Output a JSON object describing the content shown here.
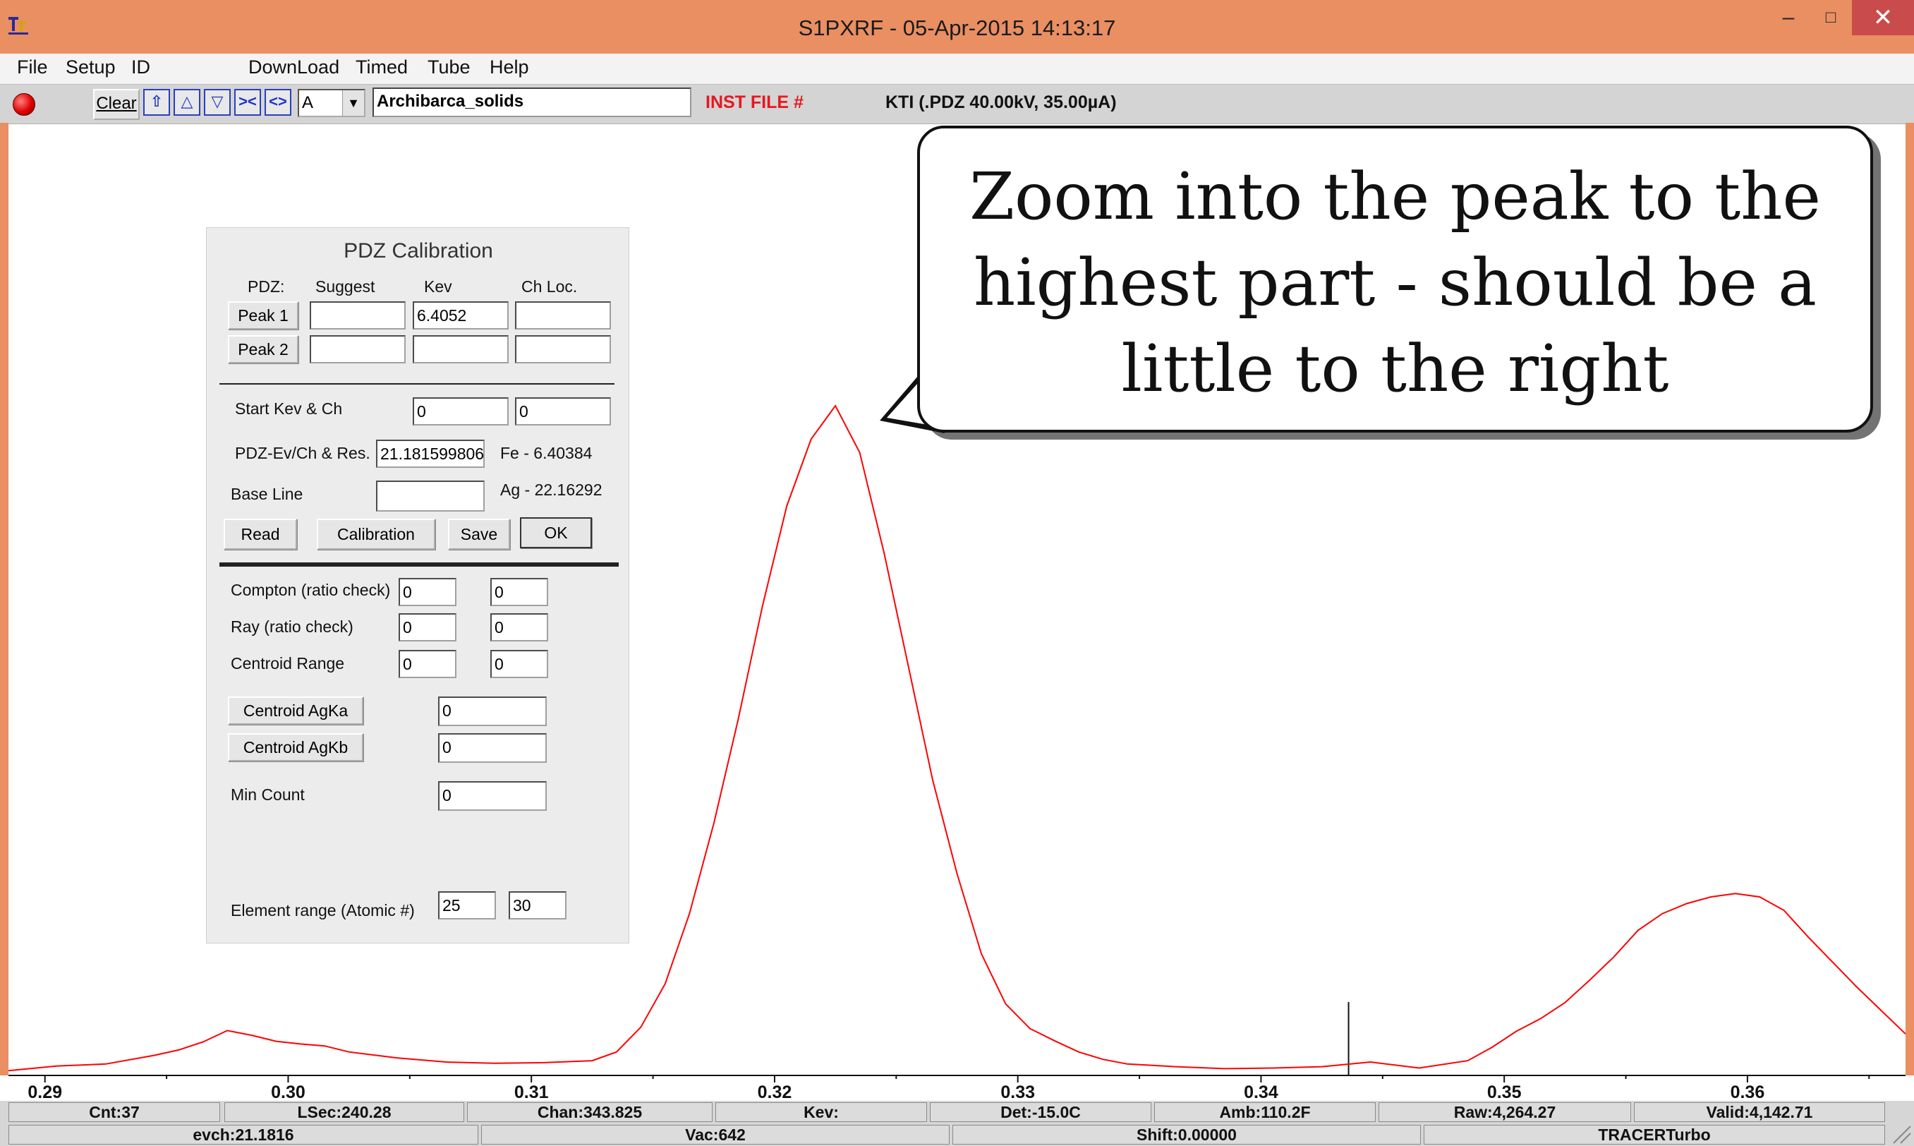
{
  "window": {
    "title": "S1PXRF - 05-Apr-2015 14:13:17",
    "controls": {
      "minimize": "–",
      "maximize": "□",
      "close": "✕"
    }
  },
  "menu": [
    "File",
    "Setup",
    "ID",
    "DownLoad",
    "Timed",
    "Tube",
    "Help"
  ],
  "toolbar": {
    "clear_label": "Clear",
    "nav_buttons": [
      "home-up-icon",
      "arrow-up-icon",
      "arrow-down-icon",
      "collapse-icon",
      "expand-icon"
    ],
    "nav_glyphs": [
      "⇧",
      "△",
      "▽",
      "><",
      "<>"
    ],
    "channel_value": "A",
    "file_name": "Archibarca_solids",
    "inst_file_label": "INST FILE #",
    "kti_label": "KTI  (.PDZ 40.00kV, 35.00µA)",
    "status_led_color": "#e00000"
  },
  "pdz_panel": {
    "title": "PDZ Calibration",
    "col_headers": {
      "pdz": "PDZ:",
      "suggest": "Suggest",
      "kev": "Kev",
      "chloc": "Ch Loc."
    },
    "peak1": {
      "label": "Peak 1",
      "suggest": "",
      "kev": "6.4052",
      "chloc": ""
    },
    "peak2": {
      "label": "Peak 2",
      "suggest": "",
      "kev": "",
      "chloc": ""
    },
    "start_kev_label": "Start Kev & Ch",
    "start_kev": "0",
    "start_ch": "0",
    "ev_ch_label": "PDZ-Ev/Ch & Res.",
    "ev_ch_value": "21.181599806",
    "fe_ref": "Fe - 6.40384",
    "baseline_label": "Base Line",
    "baseline_value": "",
    "ag_ref": "Ag - 22.16292",
    "buttons": {
      "read": "Read",
      "calibration": "Calibration",
      "save": "Save",
      "ok": "OK"
    },
    "compton_label": "Compton (ratio check)",
    "compton": [
      "0",
      "0"
    ],
    "ray_label": "Ray (ratio check)",
    "ray": [
      "0",
      "0"
    ],
    "centroid_range_label": "Centroid Range",
    "centroid_range": [
      "0",
      "0"
    ],
    "centroid_agka_label": "Centroid AgKa",
    "centroid_agka": "0",
    "centroid_agkb_label": "Centroid AgKb",
    "centroid_agkb": "0",
    "min_count_label": "Min Count",
    "min_count": "0",
    "element_range_label": "Element range (Atomic #)",
    "element_range": [
      "25",
      "30"
    ]
  },
  "callout": {
    "line1": "Zoom into the peak to the",
    "line2": "highest part - should be a",
    "line3": "little to the right"
  },
  "chart_data": {
    "type": "line",
    "x_tick_labels": [
      "0.29",
      "0.30",
      "0.31",
      "0.32",
      "0.33",
      "0.34",
      "0.35",
      "0.36"
    ],
    "xlim": [
      0.2885,
      0.3665
    ],
    "ylim": [
      0,
      100
    ],
    "cursor_x": 0.3436,
    "line_color": "#ff0000",
    "series": [
      {
        "x": [
          0.2885,
          0.2905,
          0.2925,
          0.2945,
          0.2955,
          0.2965,
          0.2975,
          0.2985,
          0.2995,
          0.3005,
          0.3015,
          0.3025,
          0.3045,
          0.3065,
          0.3085,
          0.3105,
          0.3125,
          0.3135,
          0.3145,
          0.3155,
          0.3165,
          0.3175,
          0.3185,
          0.3195,
          0.3205,
          0.3215,
          0.3225,
          0.3235,
          0.3245,
          0.3255,
          0.3265,
          0.3275,
          0.3285,
          0.3295,
          0.3305,
          0.3315,
          0.3325,
          0.3335,
          0.3345,
          0.3365,
          0.3385,
          0.3405,
          0.3425,
          0.3445,
          0.3465,
          0.3485,
          0.3495,
          0.3505,
          0.3515,
          0.3525,
          0.3535,
          0.3545,
          0.3555,
          0.3565,
          0.3575,
          0.3585,
          0.3595,
          0.3605,
          0.3615,
          0.3625,
          0.3645,
          0.3665
        ],
        "y": [
          0.5,
          1.2,
          1.5,
          2.8,
          3.6,
          4.8,
          6.5,
          5.8,
          4.9,
          4.5,
          4.2,
          3.3,
          2.4,
          1.8,
          1.6,
          1.7,
          2.0,
          3.3,
          7.0,
          13.5,
          24.0,
          37.5,
          53.0,
          70.0,
          85.0,
          95.0,
          100.0,
          93.0,
          78.0,
          61.0,
          44.0,
          30.0,
          18.0,
          10.5,
          6.8,
          5.0,
          3.3,
          2.2,
          1.5,
          1.1,
          0.8,
          0.9,
          1.1,
          1.8,
          0.9,
          2.0,
          4.0,
          6.4,
          8.3,
          10.7,
          14.0,
          17.5,
          21.5,
          24.0,
          25.5,
          26.5,
          27.0,
          26.5,
          24.5,
          20.5,
          13.0,
          6.0
        ]
      }
    ]
  },
  "status_row1": [
    "Cnt:37",
    "LSec:240.28",
    "Chan:343.825",
    "Kev:",
    "Det:-15.0C",
    "Amb:110.2F",
    "Raw:4,264.27",
    "Valid:4,142.71"
  ],
  "status_row2": [
    "evch:21.1816",
    "Vac:642",
    "Shift:0.00000",
    "TRACERTurbo"
  ]
}
